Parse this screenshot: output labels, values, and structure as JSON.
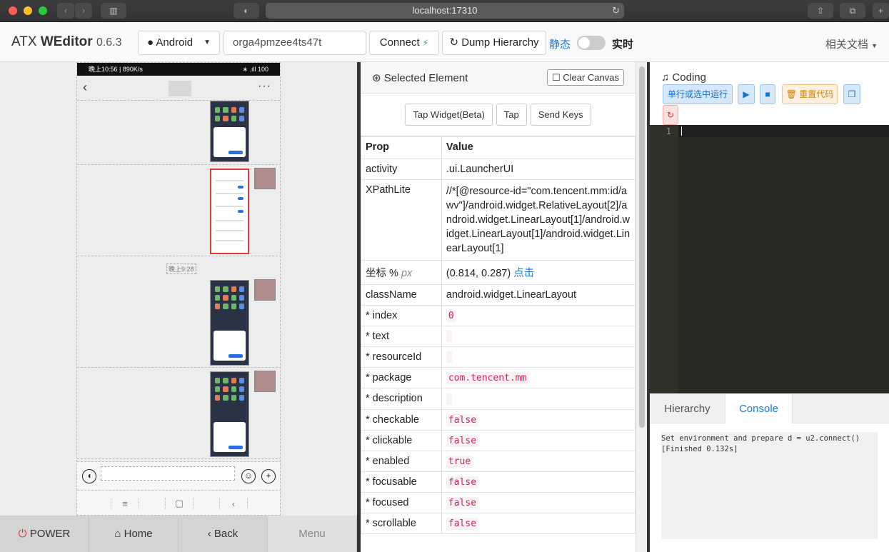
{
  "browser": {
    "url": "localhost:17310"
  },
  "navbar": {
    "brand_prefix": "ATX ",
    "brand_name": "WEditor",
    "version": "0.6.3",
    "platform": "Android",
    "device_serial": "orga4pmzee4ts47t",
    "connect_label": "Connect",
    "dump_label": "Dump Hierarchy",
    "static_label": "静态",
    "live_label": "实时",
    "docs_label": "相关文档"
  },
  "phone": {
    "status_time": "晚上10:56 | 890K/s",
    "status_right": "∗ .ıll 100",
    "time_label": "晚上9:28"
  },
  "device_buttons": {
    "power": "POWER",
    "home": "Home",
    "back": "Back",
    "menu": "Menu"
  },
  "selected": {
    "title": "Selected Element",
    "clear_canvas": "Clear Canvas",
    "actions": [
      "Tap Widget(Beta)",
      "Tap",
      "Send Keys"
    ],
    "header_prop": "Prop",
    "header_value": "Value",
    "activity_key": "activity",
    "activity": ".ui.LauncherUI",
    "xpath_key": "XPathLite",
    "xpath": "//*[@resource-id=\"com.tencent.mm:id/awv\"]/android.widget.RelativeLayout[2]/android.widget.LinearLayout[1]/android.widget.LinearLayout[1]/android.widget.LinearLayout[1]",
    "coord_key": "坐标 %",
    "coord_unit": "px",
    "coord_value": "(0.814, 0.287)",
    "coord_link": "点击",
    "classname_key": "className",
    "classname": "android.widget.LinearLayout",
    "props": [
      {
        "key": "* index",
        "value": "0"
      },
      {
        "key": "* text",
        "value": ""
      },
      {
        "key": "* resourceId",
        "value": ""
      },
      {
        "key": "* package",
        "value": "com.tencent.mm"
      },
      {
        "key": "* description",
        "value": ""
      },
      {
        "key": "* checkable",
        "value": "false"
      },
      {
        "key": "* clickable",
        "value": "false"
      },
      {
        "key": "* enabled",
        "value": "true"
      },
      {
        "key": "* focusable",
        "value": "false"
      },
      {
        "key": "* focused",
        "value": "false"
      },
      {
        "key": "* scrollable",
        "value": "false"
      }
    ]
  },
  "coding": {
    "title": "Coding",
    "run_line": "单行或选中运行",
    "reset_code": "重置代码",
    "line_number": "1"
  },
  "bottom_tabs": {
    "hierarchy": "Hierarchy",
    "console": "Console"
  },
  "console": {
    "line1": "Set environment and prepare d = u2.connect()",
    "line2": "[Finished 0.132s]"
  }
}
